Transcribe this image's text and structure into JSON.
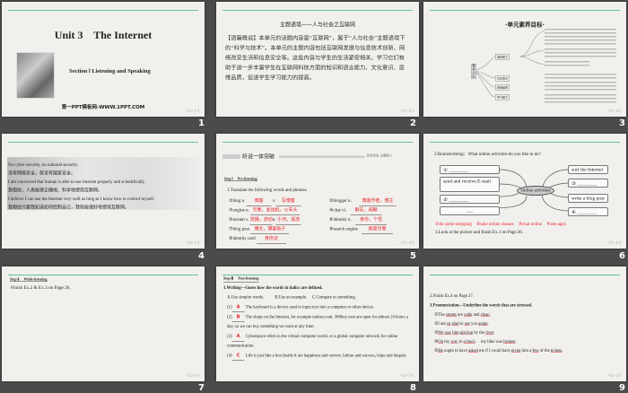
{
  "slides": [
    {
      "number": "1",
      "title": "Unit 3    The Internet",
      "section": "Section Ⅰ  Listening and Speaking",
      "watermark": "第一PPT模板网-WWW.1PPT.COM"
    },
    {
      "number": "2",
      "heading": "主题语境——人与社会之互联网",
      "body": "【语篇概说】本单元的话题内容是“互联网”，属于“人与社会”主题语境下的“科学与技术”。本单元的主题内容包括互联网发展与信息技术创新、网络改变生活和信息安全等。这些内容与学生的生活紧密相关，学习它们有助于进一步丰富学生在互联网科技方面的知识和语言能力、文化意识、思维品质，促进学生学习能力的提高。"
    },
    {
      "number": "3",
      "title": "·单元素养目标·",
      "root": "素养目标",
      "branches": [
        "语言能力",
        "文化意识",
        "思维品质",
        "学习能力"
      ]
    },
    {
      "number": "4",
      "lines": [
        "No cyber security, no national security.",
        "没有网络安全，就没有国家安全。",
        "I am convinced that human is able to use Internet properly and scientifically.",
        "我相信，人类能够正确地、科学地使用互联网。",
        "I believe I can use the Internet very well as long as I know how to control myself.",
        "我相信只要我知道如何控制自己，我就能很好地使用互联网。"
      ]
    },
    {
      "number": "5",
      "header": "听说一体突破",
      "header_right": "先听后说 主题导入",
      "step": "Step Ⅰ",
      "step_title": "Pre-listening",
      "task": "1.Translate the following words and phrases.",
      "items": [
        {
          "label": "①blog  n.",
          "answer": "博客",
          "label2": "v.",
          "answer2": "写博客"
        },
        {
          "label": "②blogger n.",
          "answer": "博客作者，博主"
        },
        {
          "label": "③engine n.",
          "answer": "引擎，发动机，火车头"
        },
        {
          "label": "④chat vi.",
          "answer": "聊天，闲聊"
        },
        {
          "label": "⑤stream  v.",
          "answer": "流播，流动",
          "label2": "n.",
          "answer2": "小河，溪流"
        },
        {
          "label": "⑥identity n.",
          "answer": "身份，个性"
        },
        {
          "label": "⑦blog post",
          "answer": "博文，博客帖子"
        },
        {
          "label": "⑧search engine",
          "answer": "搜索引擎"
        },
        {
          "label": "⑨identity card",
          "answer": "身份证"
        }
      ]
    },
    {
      "number": "6",
      "task": "2.Brainstorming：What online activities do you like to do?",
      "center": "Online activities",
      "left": [
        "① ________",
        "send and receive E-mail",
        "② ________",
        "......"
      ],
      "right": [
        "surf the Internet",
        "③ ________",
        "write a blog post",
        "④ ________"
      ],
      "answers": [
        "①do some shopping",
        "②take online classes",
        "③chat online",
        "④use apps"
      ],
      "task2": "3.Look at the picture and finish Ex.1 on Page 26."
    },
    {
      "number": "7",
      "step": "Step Ⅱ",
      "step_title": "While-listening",
      "text": "Finish Ex.2 & Ex.3 on Page 26."
    },
    {
      "number": "8",
      "step": "Step Ⅲ",
      "step_title": "Post-listening",
      "task": "1.Writing—Guess how the words in italics are defined.",
      "options": "A.Use simpler words.          B.Use an example.     C.Compare to something.",
      "items": [
        {
          "no": "(1)",
          "ans": "A",
          "text": "The keyboard is a device used to input text into a computer or other device."
        },
        {
          "no": "(2)",
          "ans": "B",
          "text": "The shops on the Internet, for example taobao.com, 360buy.com are open for almost 24 hours a day, so we can buy something we want at any time."
        },
        {
          "no": "(3)",
          "ans": "A",
          "text": "Cyberspace refers to the virtual computer world, or a global computer network for online communication."
        },
        {
          "no": "(4)",
          "ans": "C",
          "text": "Life is just like a box.Inside it are happiness and sorrow, failure and success, hope and despair."
        }
      ]
    },
    {
      "number": "9",
      "line1": "2.Finish Ex.4 on Page 27.",
      "task": "3.Pronunciation—Underline the words that are stressed.",
      "sentences": [
        [
          [
            "①The "
          ],
          [
            "streets",
            1
          ],
          [
            " are "
          ],
          [
            "wide",
            1
          ],
          [
            " and "
          ],
          [
            "clean",
            1
          ],
          [
            "."
          ]
        ],
        [
          [
            "②I am "
          ],
          [
            "so",
            1
          ],
          [
            " "
          ],
          [
            "glad",
            1
          ],
          [
            " to "
          ],
          [
            "see",
            1
          ],
          [
            " you "
          ],
          [
            "again",
            1
          ],
          [
            "."
          ]
        ],
        [
          [
            "③"
          ],
          [
            "We",
            1
          ],
          [
            " "
          ],
          [
            "saw",
            1
          ],
          [
            " "
          ],
          [
            "him",
            1
          ],
          [
            " "
          ],
          [
            "playing",
            1
          ],
          [
            " by the "
          ],
          [
            "river",
            1
          ],
          [
            "."
          ]
        ],
        [
          [
            "④"
          ],
          [
            "On",
            1
          ],
          [
            " my "
          ],
          [
            "way",
            1
          ],
          [
            " to "
          ],
          [
            "school",
            1
          ],
          [
            "，  my bike was "
          ],
          [
            "broken",
            1
          ],
          [
            "."
          ]
        ],
        [
          [
            "⑤"
          ],
          [
            "He",
            1
          ],
          [
            " ought to have "
          ],
          [
            "asked",
            1
          ],
          [
            " me if I could have "
          ],
          [
            "given",
            1
          ],
          [
            " him a "
          ],
          [
            "few",
            1
          ],
          [
            " of the "
          ],
          [
            "tickets",
            1
          ],
          [
            "."
          ]
        ]
      ]
    }
  ]
}
